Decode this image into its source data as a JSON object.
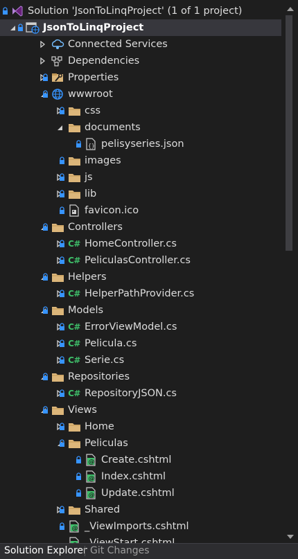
{
  "window": {
    "title": "Solution Explorer"
  },
  "tree": {
    "items": [
      {
        "label": "Solution 'JsonToLinqProject' (1 of 1 project)",
        "level": 0,
        "icon": "solution-icon",
        "expander": "none",
        "lock": true,
        "bold": false
      },
      {
        "label": "JsonToLinqProject",
        "level": 0,
        "icon": "web-project-icon",
        "expander": "expanded",
        "lock": true,
        "bold": true,
        "selected": true
      },
      {
        "label": "Connected Services",
        "level": 1,
        "icon": "connected-services-icon",
        "expander": "collapsed",
        "lock": false
      },
      {
        "label": "Dependencies",
        "level": 1,
        "icon": "dependencies-icon",
        "expander": "collapsed",
        "lock": false
      },
      {
        "label": "Properties",
        "level": 1,
        "icon": "properties-icon",
        "expander": "collapsed",
        "lock": true
      },
      {
        "label": "wwwroot",
        "level": 1,
        "icon": "globe-icon",
        "expander": "expanded",
        "lock": true
      },
      {
        "label": "css",
        "level": 2,
        "icon": "folder-icon",
        "expander": "collapsed",
        "lock": true
      },
      {
        "label": "documents",
        "level": 2,
        "icon": "folder-icon",
        "expander": "expanded",
        "lock": false
      },
      {
        "label": "pelisyseries.json",
        "level": 3,
        "icon": "json-file-icon",
        "expander": "none",
        "lock": true
      },
      {
        "label": "images",
        "level": 2,
        "icon": "folder-icon",
        "expander": "none",
        "lock": true
      },
      {
        "label": "js",
        "level": 2,
        "icon": "folder-icon",
        "expander": "collapsed",
        "lock": true
      },
      {
        "label": "lib",
        "level": 2,
        "icon": "folder-icon",
        "expander": "collapsed",
        "lock": true
      },
      {
        "label": "favicon.ico",
        "level": 2,
        "icon": "ico-file-icon",
        "expander": "none",
        "lock": true
      },
      {
        "label": "Controllers",
        "level": 1,
        "icon": "folder-icon",
        "expander": "expanded",
        "lock": true
      },
      {
        "label": "HomeController.cs",
        "level": 2,
        "icon": "csharp-icon",
        "expander": "collapsed",
        "lock": true
      },
      {
        "label": "PeliculasController.cs",
        "level": 2,
        "icon": "csharp-icon",
        "expander": "collapsed",
        "lock": true
      },
      {
        "label": "Helpers",
        "level": 1,
        "icon": "folder-icon",
        "expander": "expanded",
        "lock": true
      },
      {
        "label": "HelperPathProvider.cs",
        "level": 2,
        "icon": "csharp-icon",
        "expander": "collapsed",
        "lock": true
      },
      {
        "label": "Models",
        "level": 1,
        "icon": "folder-icon",
        "expander": "expanded",
        "lock": true
      },
      {
        "label": "ErrorViewModel.cs",
        "level": 2,
        "icon": "csharp-icon",
        "expander": "collapsed",
        "lock": true
      },
      {
        "label": "Pelicula.cs",
        "level": 2,
        "icon": "csharp-icon",
        "expander": "collapsed",
        "lock": true
      },
      {
        "label": "Serie.cs",
        "level": 2,
        "icon": "csharp-icon",
        "expander": "collapsed",
        "lock": true
      },
      {
        "label": "Repositories",
        "level": 1,
        "icon": "folder-icon",
        "expander": "expanded",
        "lock": true
      },
      {
        "label": "RepositoryJSON.cs",
        "level": 2,
        "icon": "csharp-icon",
        "expander": "collapsed",
        "lock": true
      },
      {
        "label": "Views",
        "level": 1,
        "icon": "folder-icon",
        "expander": "expanded",
        "lock": true
      },
      {
        "label": "Home",
        "level": 2,
        "icon": "folder-icon",
        "expander": "collapsed",
        "lock": true
      },
      {
        "label": "Peliculas",
        "level": 2,
        "icon": "folder-icon",
        "expander": "expanded",
        "lock": true
      },
      {
        "label": "Create.cshtml",
        "level": 3,
        "icon": "razor-file-icon",
        "expander": "none",
        "lock": true
      },
      {
        "label": "Index.cshtml",
        "level": 3,
        "icon": "razor-file-icon",
        "expander": "none",
        "lock": true
      },
      {
        "label": "Update.cshtml",
        "level": 3,
        "icon": "razor-file-icon",
        "expander": "none",
        "lock": true
      },
      {
        "label": "Shared",
        "level": 2,
        "icon": "folder-icon",
        "expander": "collapsed",
        "lock": true
      },
      {
        "label": "_ViewImports.cshtml",
        "level": 2,
        "icon": "razor-file-icon",
        "expander": "none",
        "lock": true
      },
      {
        "label": "_ViewStart.cshtml",
        "level": 2,
        "icon": "razor-file-icon",
        "expander": "none",
        "lock": false
      }
    ]
  },
  "bottom_tabs": [
    {
      "label": "Solution Explorer",
      "active": true
    },
    {
      "label": "Git Changes",
      "active": false
    }
  ],
  "colors": {
    "background": "#1e1e1e",
    "selected_row": "#37373d",
    "folder": "#dcb67a",
    "csharp": "#3fbf6a",
    "lock": "#3794ff"
  }
}
